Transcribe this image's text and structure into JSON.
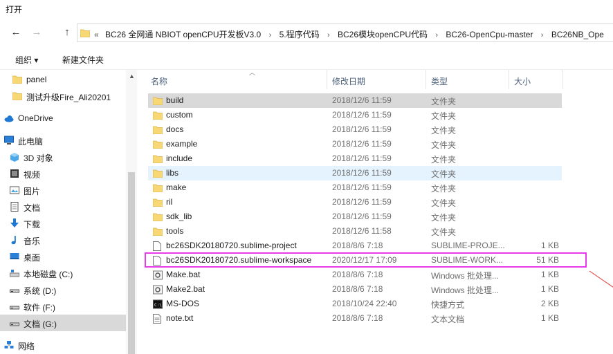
{
  "window": {
    "title": "打开"
  },
  "nav": {
    "back": "←",
    "forward": "→",
    "up": "↑"
  },
  "address": {
    "lead": "«",
    "crumbs": [
      "BC26 全网通 NBIOT openCPU开发板V3.0",
      "5.程序代码",
      "BC26模块openCPU代码",
      "BC26-OpenCpu-master",
      "BC26NB_Ope"
    ],
    "sep": "›"
  },
  "toolbar": {
    "organize": "组织 ▾",
    "new_folder": "新建文件夹"
  },
  "sidebar": {
    "items": [
      {
        "label": "panel",
        "icon": "folder-icon"
      },
      {
        "label": "测试升级Fire_Ali20201",
        "icon": "folder-icon"
      },
      {
        "label": "OneDrive",
        "icon": "cloud-icon"
      },
      {
        "label": "此电脑",
        "icon": "computer-icon"
      },
      {
        "label": "3D 对象",
        "icon": "cube-icon"
      },
      {
        "label": "视频",
        "icon": "video-icon"
      },
      {
        "label": "图片",
        "icon": "picture-icon"
      },
      {
        "label": "文档",
        "icon": "document-icon"
      },
      {
        "label": "下载",
        "icon": "download-icon"
      },
      {
        "label": "音乐",
        "icon": "music-icon"
      },
      {
        "label": "桌面",
        "icon": "desktop-icon"
      },
      {
        "label": "本地磁盘 (C:)",
        "icon": "disk-icon"
      },
      {
        "label": "系统 (D:)",
        "icon": "drive-icon"
      },
      {
        "label": "软件 (F:)",
        "icon": "drive-icon"
      },
      {
        "label": "文档 (G:)",
        "icon": "drive-icon"
      },
      {
        "label": "网络",
        "icon": "network-icon"
      }
    ]
  },
  "columns": {
    "name": "名称",
    "date": "修改日期",
    "type": "类型",
    "size": "大小"
  },
  "files": [
    {
      "name": "build",
      "date": "2018/12/6 11:59",
      "type": "文件夹",
      "size": "",
      "icon": "folder-icon"
    },
    {
      "name": "custom",
      "date": "2018/12/6 11:59",
      "type": "文件夹",
      "size": "",
      "icon": "folder-icon"
    },
    {
      "name": "docs",
      "date": "2018/12/6 11:59",
      "type": "文件夹",
      "size": "",
      "icon": "folder-icon"
    },
    {
      "name": "example",
      "date": "2018/12/6 11:59",
      "type": "文件夹",
      "size": "",
      "icon": "folder-icon"
    },
    {
      "name": "include",
      "date": "2018/12/6 11:59",
      "type": "文件夹",
      "size": "",
      "icon": "folder-icon"
    },
    {
      "name": "libs",
      "date": "2018/12/6 11:59",
      "type": "文件夹",
      "size": "",
      "icon": "folder-icon"
    },
    {
      "name": "make",
      "date": "2018/12/6 11:59",
      "type": "文件夹",
      "size": "",
      "icon": "folder-icon"
    },
    {
      "name": "ril",
      "date": "2018/12/6 11:59",
      "type": "文件夹",
      "size": "",
      "icon": "folder-icon"
    },
    {
      "name": "sdk_lib",
      "date": "2018/12/6 11:59",
      "type": "文件夹",
      "size": "",
      "icon": "folder-icon"
    },
    {
      "name": "tools",
      "date": "2018/12/6 11:58",
      "type": "文件夹",
      "size": "",
      "icon": "folder-icon"
    },
    {
      "name": "bc26SDK20180720.sublime-project",
      "date": "2018/8/6 7:18",
      "type": "SUBLIME-PROJE...",
      "size": "1 KB",
      "icon": "file-icon"
    },
    {
      "name": "bc26SDK20180720.sublime-workspace",
      "date": "2020/12/17 17:09",
      "type": "SUBLIME-WORK...",
      "size": "51 KB",
      "icon": "file-icon"
    },
    {
      "name": "Make.bat",
      "date": "2018/8/6 7:18",
      "type": "Windows 批处理...",
      "size": "1 KB",
      "icon": "batch-icon"
    },
    {
      "name": "Make2.bat",
      "date": "2018/8/6 7:18",
      "type": "Windows 批处理...",
      "size": "1 KB",
      "icon": "batch-icon"
    },
    {
      "name": "MS-DOS",
      "date": "2018/10/24 22:40",
      "type": "快捷方式",
      "size": "2 KB",
      "icon": "shortcut-icon"
    },
    {
      "name": "note.txt",
      "date": "2018/8/6 7:18",
      "type": "文本文档",
      "size": "1 KB",
      "icon": "text-file-icon"
    }
  ],
  "colors": {
    "folder": "#f8d775",
    "selection": "#d9d9d9",
    "hover": "#e5f3ff",
    "annotation": "#e53be8"
  }
}
